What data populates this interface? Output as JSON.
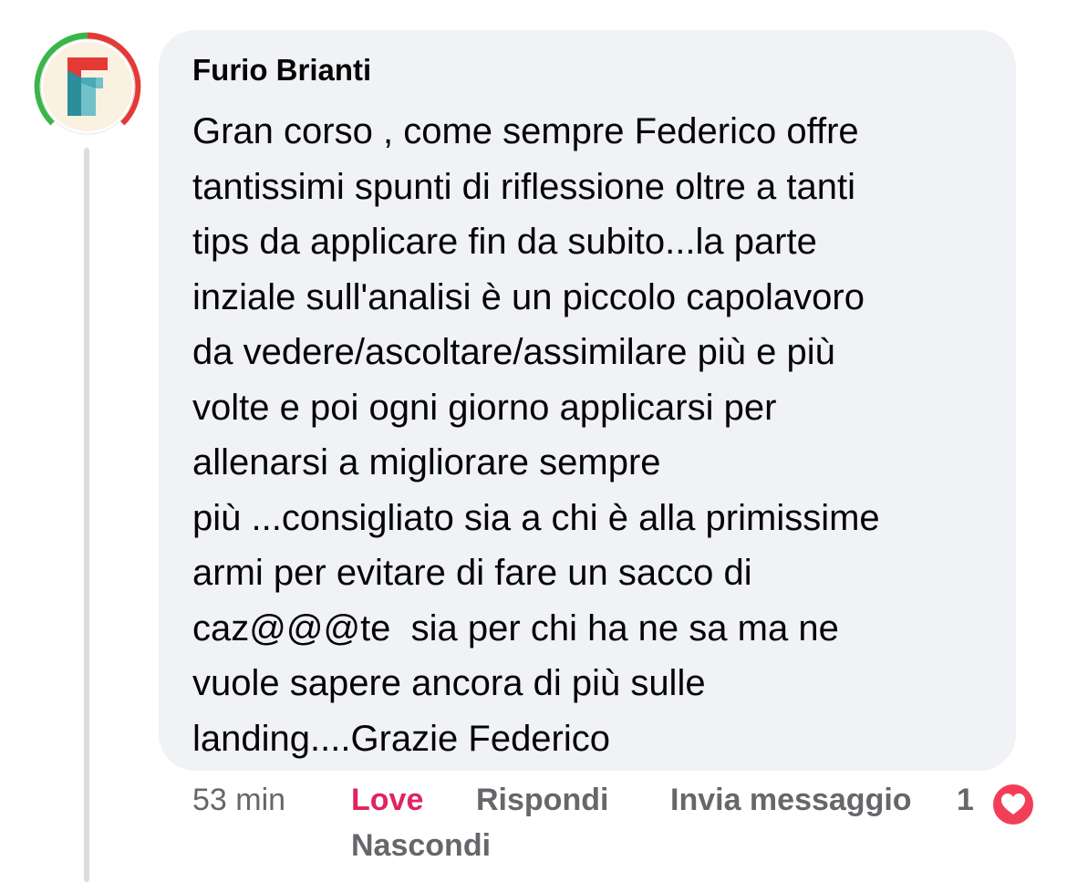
{
  "comment": {
    "author": "Furio Brianti",
    "text_lines": [
      "Gran corso , come sempre Federico offre",
      "tantissimi spunti di riflessione oltre a tanti",
      "tips da applicare fin da subito...la parte",
      "inziale sull'analisi è un piccolo capolavoro",
      "da vedere/ascoltare/assimilare più e più",
      "volte e poi ogni giorno applicarsi per",
      "allenarsi a migliorare sempre",
      "più ...consigliato sia a chi è alla primissime",
      "armi per evitare di fare un sacco di",
      "caz@@@te  sia per chi ha ne sa ma ne",
      "vuole sapere ancora di più sulle",
      "landing....Grazie Federico"
    ]
  },
  "actions": {
    "time": "53 min",
    "love": "Love",
    "reply": "Rispondi",
    "message": "Invia messaggio",
    "reaction_count": "1",
    "hide": "Nascondi"
  },
  "icons": {
    "avatar": "avatar-logo-f",
    "reaction": "heart-icon"
  },
  "colors": {
    "bubble": "#f0f2f5",
    "love": "#e0245e",
    "muted": "#65676b",
    "heart": "#f33e58"
  }
}
